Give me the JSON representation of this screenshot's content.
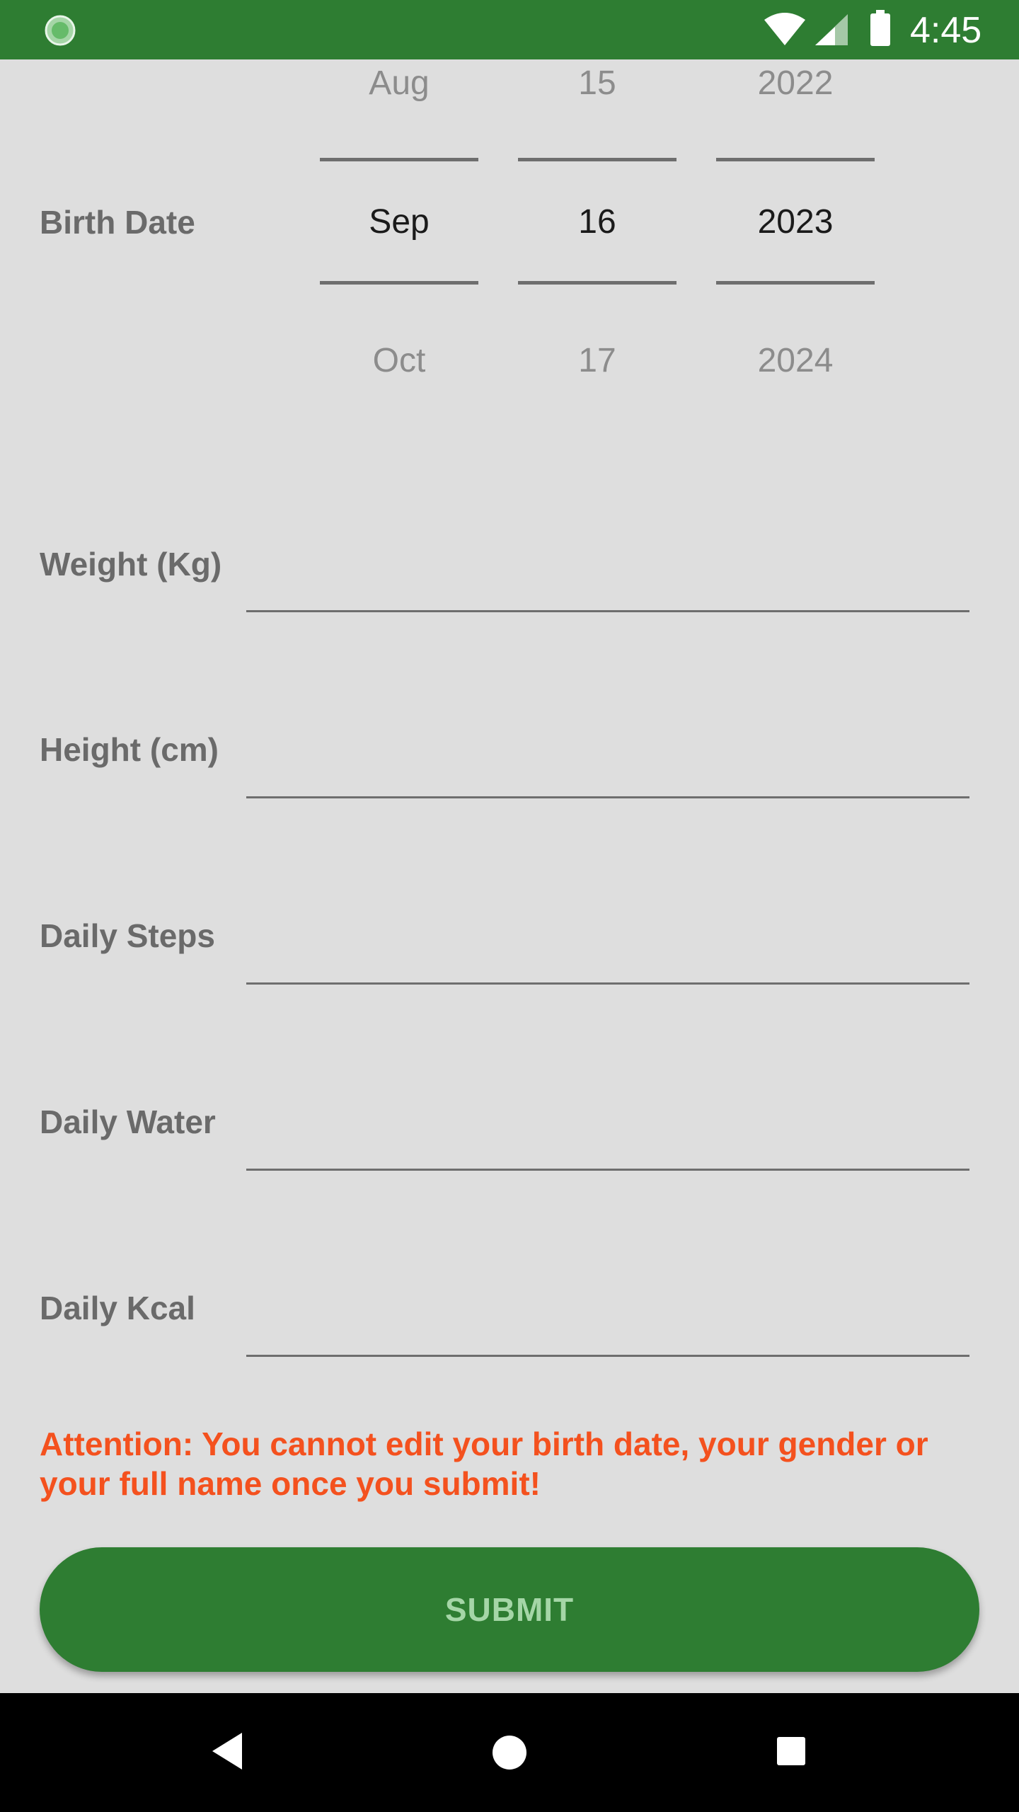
{
  "status_bar": {
    "time": "4:45",
    "icons": [
      "app-notification-icon",
      "wifi-icon",
      "cell-signal-icon",
      "battery-icon"
    ],
    "background": "#2e7d32"
  },
  "birth_date": {
    "label": "Birth Date",
    "month": {
      "prev": "Aug",
      "selected": "Sep",
      "next": "Oct"
    },
    "day": {
      "prev": "15",
      "selected": "16",
      "next": "17"
    },
    "year": {
      "prev": "2022",
      "selected": "2023",
      "next": "2024"
    }
  },
  "fields": {
    "weight": {
      "label": "Weight (Kg)",
      "value": ""
    },
    "height": {
      "label": "Height (cm)",
      "value": ""
    },
    "steps": {
      "label": "Daily Steps",
      "value": ""
    },
    "water": {
      "label": "Daily Water",
      "value": ""
    },
    "kcal": {
      "label": "Daily Kcal",
      "value": ""
    }
  },
  "attention_text": "Attention: You cannot edit your birth date, your gender or your full name once you submit!",
  "submit_label": "SUBMIT",
  "colors": {
    "accent": "#2e7d32",
    "warning": "#f4511e",
    "button_text": "#a5d6a7",
    "background": "#dedede"
  },
  "nav_bar": {
    "icons": [
      "back-icon",
      "home-icon",
      "recents-icon"
    ]
  }
}
